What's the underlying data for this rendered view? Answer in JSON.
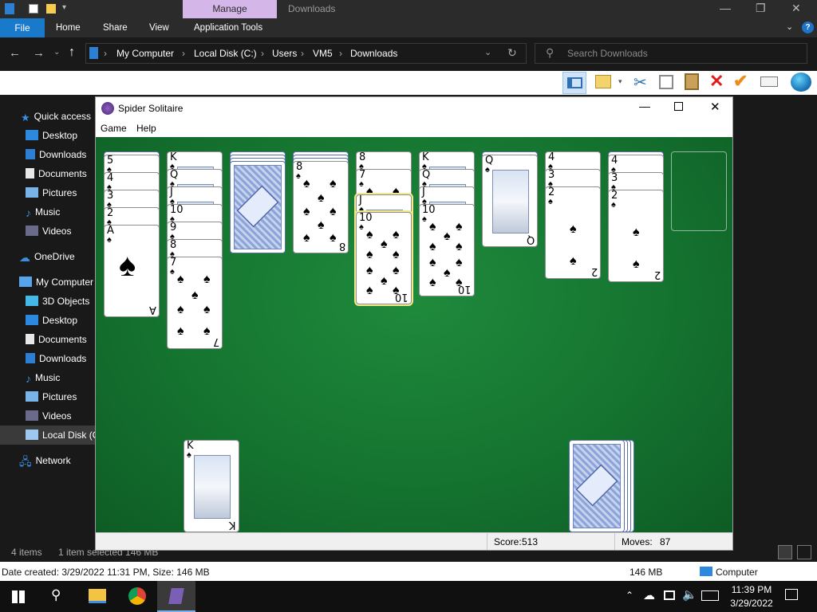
{
  "explorer": {
    "ribbon_context_tab": "Manage",
    "title": "Downloads",
    "tabs": [
      "File",
      "Home",
      "Share",
      "View",
      "Application Tools"
    ],
    "breadcrumb": [
      "My Computer",
      "Local Disk (C:)",
      "Users",
      "VM5",
      "Downloads"
    ],
    "search_placeholder": "Search Downloads",
    "nav": [
      "Quick access",
      "Desktop",
      "Downloads",
      "Documents",
      "Pictures",
      "Music",
      "Videos",
      "OneDrive",
      "My Computer",
      "3D Objects",
      "Desktop",
      "Documents",
      "Downloads",
      "Music",
      "Pictures",
      "Videos",
      "Local Disk (C:)",
      "Network"
    ],
    "status": {
      "items": "4 items",
      "selected": "1 item selected  146 MB"
    },
    "details": {
      "created": "Date created: 3/29/2022 11:31 PM, Size: 146 MB",
      "size": "146 MB",
      "location": "Computer"
    }
  },
  "game": {
    "window_title": "Spider Solitaire",
    "menu": [
      "Game",
      "Help"
    ],
    "score_label": "Score:",
    "score": "513",
    "moves_label": "Moves:",
    "moves": "87",
    "suit": "♠",
    "columns": [
      {
        "hidden": 1,
        "cards": [
          "5",
          "4",
          "3",
          "2",
          "A"
        ]
      },
      {
        "hidden": 0,
        "cards": [
          "K",
          "Q",
          "J",
          "10",
          "9",
          "8",
          "7"
        ]
      },
      {
        "hidden": 4,
        "cards": []
      },
      {
        "hidden": 3,
        "cards": [
          "8"
        ]
      },
      {
        "hidden": 0,
        "cards": [
          "8",
          "7",
          "J",
          "10"
        ]
      },
      {
        "hidden": 0,
        "cards": [
          "K",
          "Q",
          "J",
          "10"
        ]
      },
      {
        "hidden": 1,
        "cards": [
          "Q"
        ]
      },
      {
        "hidden": 0,
        "cards": [
          "4",
          "3",
          "2"
        ]
      },
      {
        "hidden": 1,
        "cards": [
          "4",
          "3",
          "2"
        ]
      },
      {
        "hidden": 0,
        "cards": []
      }
    ],
    "foundation_top": "K",
    "stock_piles": 4
  },
  "taskbar": {
    "time": "11:39 PM",
    "date": "3/29/2022"
  }
}
